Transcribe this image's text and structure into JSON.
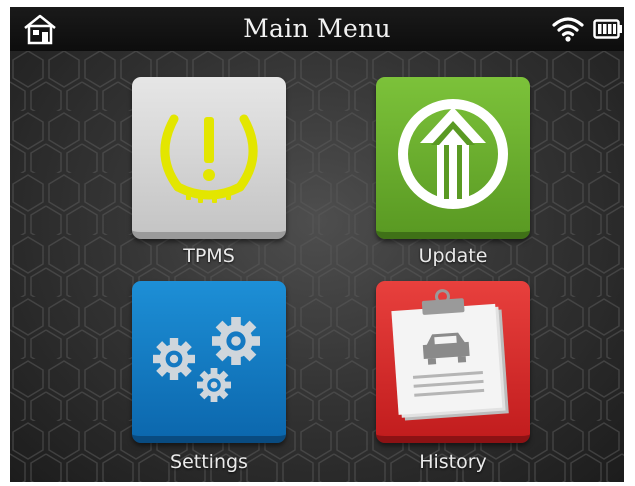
{
  "header": {
    "title": "Main Menu",
    "home_icon": "home-icon",
    "wifi_icon": "wifi-icon",
    "battery_icon": "battery-icon"
  },
  "menu": [
    {
      "label": "TPMS",
      "icon": "tpms-warning-icon",
      "color": "#d4d4d4"
    },
    {
      "label": "Update",
      "icon": "update-arrow-icon",
      "color": "#6bb030"
    },
    {
      "label": "Settings",
      "icon": "gears-icon",
      "color": "#1479c2"
    },
    {
      "label": "History",
      "icon": "clipboard-car-icon",
      "color": "#d92f2e"
    }
  ],
  "colors": {
    "tpms_symbol": "#e3e600",
    "background": "#353535"
  }
}
